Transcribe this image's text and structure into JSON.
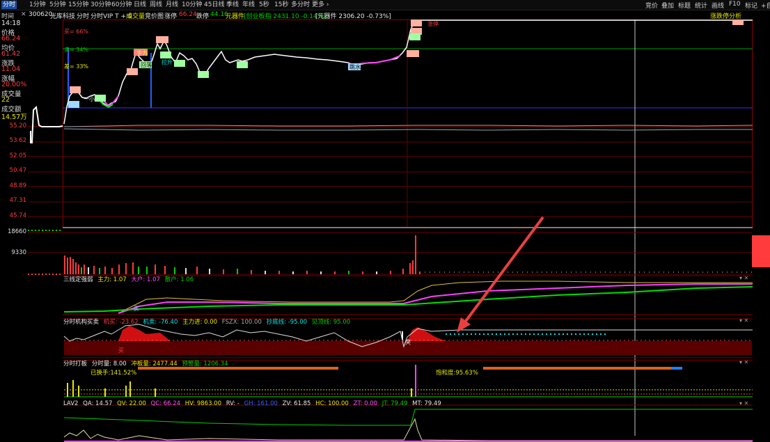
{
  "toolbar": {
    "periods": [
      "分时",
      "1分钟",
      "5分钟",
      "15分钟",
      "30分钟",
      "60分钟",
      "日线",
      "周线",
      "月线",
      "10分钟",
      "45日线",
      "季线",
      "年线",
      "5秒",
      "15秒",
      "多分时",
      "更多 ›"
    ],
    "right_items": [
      "竞价",
      "叠加",
      "标题",
      "统计",
      "画线",
      "F10",
      "标记",
      "+自"
    ]
  },
  "info": {
    "clock": "14:18",
    "code": "300620",
    "name": "光库科技",
    "view": "分时",
    "vip": "分时VIP T + 0",
    "items": [
      "成交量",
      "竞价图"
    ],
    "limit_up_label": "涨停",
    "limit_up_value": "66.24",
    "limit_down_label": "跌停",
    "limit_down_value": "44.16",
    "sector": "元器件",
    "index1": "[创业板指 2431.10 -0.14%]",
    "index2": "[元器件 2306.20 -0.73%]",
    "analysis": "涨跌停分析"
  },
  "left": {
    "time_label": "时间",
    "price_label": "价格",
    "price_value": "66.24",
    "avg_label": "均价",
    "avg_value": "61.42",
    "change_label": "涨跌",
    "change_value": "11.04",
    "pct_label": "涨幅",
    "pct_value": "20.00%",
    "vol_label": "成交量",
    "vol_value": "22",
    "amt_label": "成交额",
    "amt_value": "14.57万"
  },
  "y_axis": [
    "55.20",
    "53.62",
    "52.05",
    "50.47",
    "48.89",
    "47.31",
    "45.74"
  ],
  "vol_axis": [
    "18660",
    "9330"
  ],
  "chart_annotations": {
    "buy_label": "买= 66%",
    "sell_label": "卖= 34%",
    "diff_label": "差= 33%",
    "markers": [
      "主力",
      "大单",
      "拉升",
      "回落",
      "王",
      "抢",
      "涨停",
      "跳水",
      "回落",
      "王",
      "回落"
    ]
  },
  "panels": {
    "p1": {
      "title": "三线定强弱",
      "a": "主力: 1.07",
      "b": "大户: 1.07",
      "c": "散户: 1.06"
    },
    "p2": {
      "title": "分时机构买卖",
      "a": "机买: -23.62",
      "b": "机卖: -76.40",
      "c": "主力进: 0.00",
      "d": "FSZX: 100.00",
      "e": "抄底线: -95.00",
      "f": "见顶线: 95.00",
      "mark": "买",
      "mark2": "突",
      "mark3": "突"
    },
    "p3": {
      "title": "分时打板",
      "a": "分时量: 8.00",
      "b": "冲板量: 2477.44",
      "c": "预警量: 1206.34",
      "d": "已换手:141.52%",
      "e": "饱和度:95.63%"
    },
    "p4": {
      "title": "LAV2",
      "a": "QA: 14.57",
      "b": "QV: 22.00",
      "c": "QC: 66.24",
      "d": "HV: 9863.00",
      "e": "RV: -",
      "f": "GH: 161.00",
      "g": "ZV: 61.85",
      "h": "HC: 100.00",
      "i": "ZT: 0.00",
      "j": "JT: 79.49",
      "k": "MT: 79.49"
    }
  },
  "colors": {
    "up": "#ff3b3b",
    "down": "#00d000",
    "bg": "#000000",
    "grid": "#7a0000",
    "accent": "#1d4fa0",
    "arrow": "#e84040"
  }
}
